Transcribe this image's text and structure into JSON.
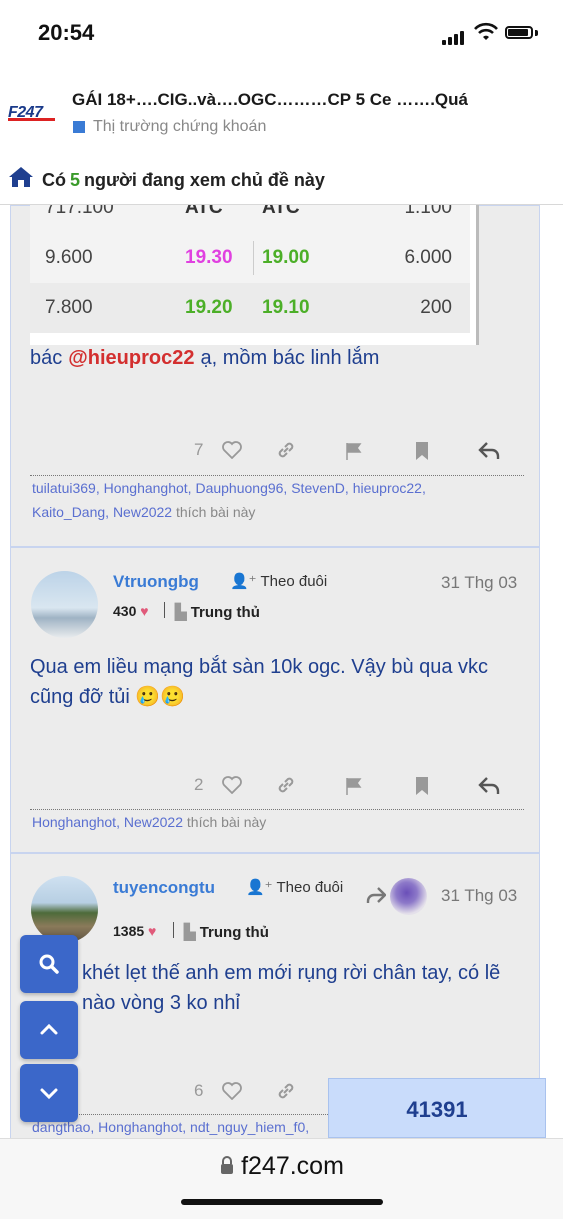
{
  "status_bar": {
    "time": "20:54"
  },
  "thread": {
    "logo": "F247",
    "title": "GÁI 18+….CIG..và….OGC………CP 5 Ce …….Quá",
    "category": "Thị trường chứng khoán",
    "category_color": "#3a7bd5"
  },
  "viewers": {
    "prefix": "Có",
    "count": "5",
    "suffix": "người đang xem chủ đề này"
  },
  "quote_table": {
    "partial_row": [
      "717.100",
      "ATC",
      "ATC",
      "1.100"
    ],
    "rows": [
      {
        "c1": "9.600",
        "c2": "19.30",
        "c2_color": "#e040e0",
        "c3": "19.00",
        "c4": "6.000"
      },
      {
        "c1": "7.800",
        "c2": "19.20",
        "c2_color": "#4caf28",
        "c3": "19.10",
        "c4": "200"
      }
    ]
  },
  "post1": {
    "text_before": "bác",
    "mention": "@hieuproc22",
    "text_after": "ạ, mồm bác linh lắm",
    "like_count": "7",
    "likers": "tuilatui369, Honghanghot, Dauphuong96, StevenD, hieuproc22, Kaito_Dang, New2022",
    "likers_suffix": "thích bài này"
  },
  "post2": {
    "username": "Vtruongbg",
    "follow_label": "Theo đuôi",
    "date": "31 Thg 03",
    "points": "430",
    "rank": "Trung thủ",
    "body": "Qua em liều mạng bắt sàn 10k ogc. Vậy bù qua vkc cũng đỡ tủi 🥲🥲",
    "like_count": "2",
    "likers": "Honghanghot, New2022",
    "likers_suffix": "thích bài này"
  },
  "post3": {
    "username": "tuyencongtu",
    "follow_label": "Theo đuôi",
    "date": "31 Thg 03",
    "points": "1385",
    "rank": "Trung thủ",
    "body": "khét lẹt thế anh em mới rụng rời chân tay, có lẽ nào vòng 3 ko nhỉ",
    "like_count": "6",
    "likers": "dangthao, Honghanghot, ndt_nguy_hiem_f0,"
  },
  "post_counter": "41391",
  "browser": {
    "url": "f247.com"
  },
  "colors": {
    "accent": "#3b67c9",
    "username": "#3a7bd5",
    "body_text": "#1f3f8f",
    "mention": "#d32f2f"
  }
}
